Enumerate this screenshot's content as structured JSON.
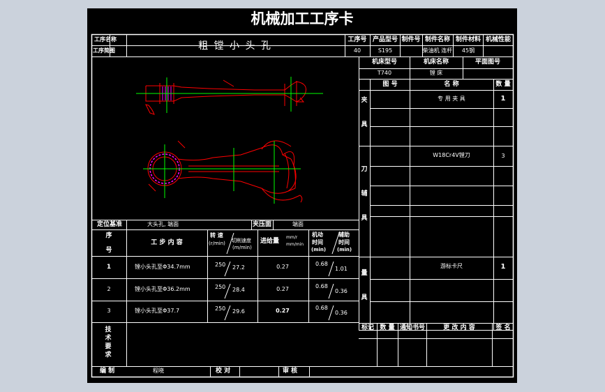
{
  "card": {
    "title": "机械加工工序卡",
    "header_labels": {
      "process_name": "工序名称",
      "process_sketch": "工序简图",
      "process_no": "工序号",
      "product_model": "产品型号",
      "part_no": "制件号",
      "part_name": "制件名称",
      "part_material": "制件材料",
      "mechanical_property": "机械性能"
    },
    "process_name_value": "粗 镗 小 头 孔",
    "process_no_value": "40",
    "product_model_value": "S195",
    "part_name_value": "柴油机 连杆",
    "part_material_value": "45钢",
    "machine_model_label": "机床型号",
    "machine_name_label": "机床名称",
    "plan_drawing_label": "平面图号",
    "machine_model_value": "T740",
    "machine_name_value": "镗 床",
    "tooling_headers": {
      "drawing_no": "图  号",
      "name": "名    称",
      "qty": "数 量"
    },
    "fixture_label": [
      "夹",
      "具"
    ],
    "cutter_label": [
      "刀",
      "辅",
      "具"
    ],
    "gauge_label": [
      "量",
      "具"
    ],
    "fixture_name": "专 用 夹 具",
    "fixture_qty": "1",
    "cutter_name": "W18Cr4V镗刀",
    "cutter_qty": "3",
    "gauge_name": "游标卡尺",
    "gauge_qty": "1",
    "locating_label": "定位基准",
    "locating_value": "大头孔, 端面",
    "clamping_label": "夹压面",
    "clamping_value": "端面",
    "step_headers": {
      "step_no_top": "序",
      "step_no_bottom": "号",
      "content": "工 步 内 容",
      "speed_top": "转  速",
      "speed_unit": "(r/min)",
      "cut_speed": "切削速度",
      "cut_speed_unit": "(m/min)",
      "feed": "进给量",
      "feed_unit_top": "mm/r",
      "feed_unit_bottom": "mm/min",
      "machine_time": "机动",
      "machine_time_2": "时间",
      "machine_time_unit": "(min)",
      "aux_time": "辅助",
      "aux_time_2": "时间",
      "aux_time_unit": "(min)"
    },
    "steps": [
      {
        "no": "1",
        "content": "镗小头孔至Φ34.7mm",
        "rpm": "250",
        "vc": "27.2",
        "feed": "0.27",
        "tm": "0.68",
        "ta": "1.01"
      },
      {
        "no": "2",
        "content": "镗小头孔至Φ36.2mm",
        "rpm": "250",
        "vc": "28.4",
        "feed": "0.27",
        "tm": "0.68",
        "ta": "0.36"
      },
      {
        "no": "3",
        "content": "镗小头孔至Φ37.7",
        "rpm": "250",
        "vc": "29.6",
        "feed": "0.27",
        "tm": "0.68",
        "ta": "0.36"
      }
    ],
    "tech_req_label": [
      "技",
      "术",
      "要",
      "求"
    ],
    "revision_headers": {
      "mark": "标记",
      "qty": "数 量",
      "notice": "通知书号",
      "content": "更 改 内 容",
      "sign": "签 名"
    },
    "footer": {
      "prepared_label": "编    制",
      "prepared_value": "程晓",
      "checked_label": "校    对",
      "approved_label": "审    核"
    }
  },
  "colors": {
    "frame": "#ffffff",
    "part_outline": "#ff0000",
    "center_line": "#00ff00",
    "hatch": "#ff00ff",
    "background": "#000000"
  }
}
